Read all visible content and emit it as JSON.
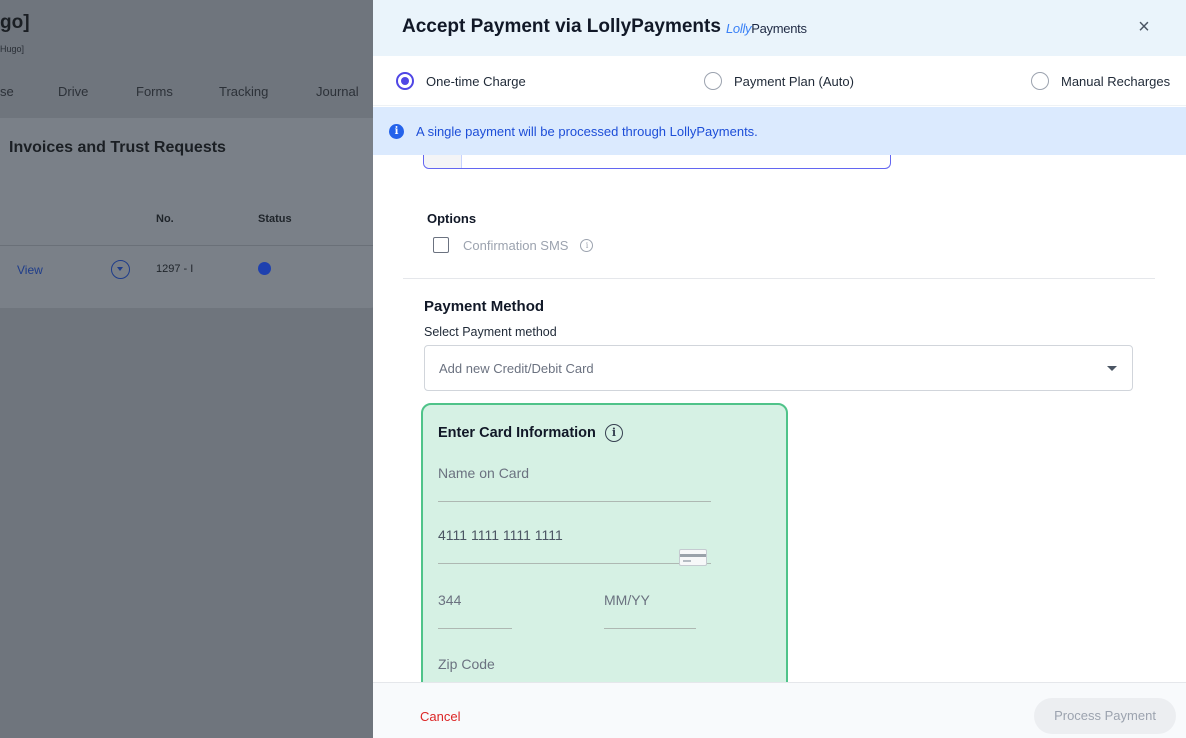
{
  "background_app": {
    "title": "go]",
    "subtitle": "Hugo]",
    "nav": [
      "se",
      "Drive",
      "Forms",
      "Tracking",
      "Journal"
    ],
    "card_title": "Invoices and Trust Requests",
    "columns": {
      "no": "No.",
      "status": "Status"
    },
    "row": {
      "action": "View",
      "number": "1297 - I"
    }
  },
  "drawer": {
    "title": "Accept Payment via LollyPayments",
    "brand_logo": {
      "part1": "Lolly",
      "part2": "Payments"
    },
    "close_label": "×",
    "payment_types": [
      {
        "label": "One-time Charge",
        "checked": true
      },
      {
        "label": "Payment Plan (Auto)",
        "checked": false
      },
      {
        "label": "Manual Recharges",
        "checked": false
      }
    ],
    "info_text": "A single payment will be processed through LollyPayments.",
    "options": {
      "label": "Options",
      "confirmation_sms": "Confirmation SMS"
    },
    "payment_method": {
      "title": "Payment Method",
      "select_label": "Select Payment method",
      "selected": "Add new Credit/Debit Card"
    },
    "card": {
      "title": "Enter Card Information",
      "name_placeholder": "Name on Card",
      "card_number": "4111 1111 1111 1111",
      "cvv": "344",
      "expiry_placeholder": "MM/YY",
      "zip_placeholder": "Zip Code"
    },
    "footer": {
      "cancel": "Cancel",
      "process": "Process Payment"
    }
  },
  "colors": {
    "accent": "#4f46e5",
    "info_bg": "#dbeafe",
    "card_bg": "#d6f1e4",
    "card_border": "#4fc389",
    "cancel": "#dc2626"
  }
}
